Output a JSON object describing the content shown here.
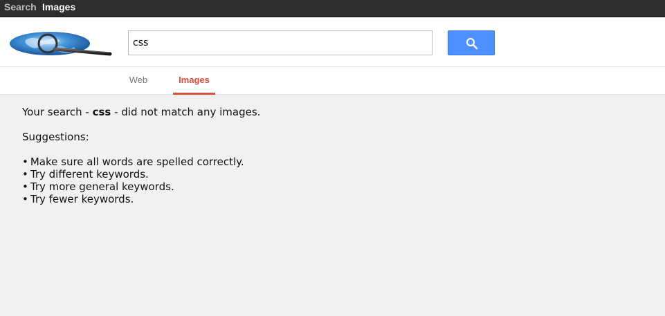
{
  "topbar": {
    "links": [
      {
        "label": "Search"
      },
      {
        "label": "Images"
      }
    ]
  },
  "header": {
    "logo_icon": "globe-magnifier-logo",
    "search": {
      "value": "css",
      "button_icon": "search-icon"
    }
  },
  "tabs": [
    {
      "label": "Web",
      "active": false
    },
    {
      "label": "Images",
      "active": true
    }
  ],
  "results": {
    "message_prefix": "Your search - ",
    "query": "css",
    "message_suffix": " - did not match any images.",
    "suggestions_title": "Suggestions:",
    "bullet": "•",
    "suggestions": [
      "Make sure all words are spelled correctly.",
      "Try different keywords.",
      "Try more general keywords.",
      "Try fewer keywords."
    ]
  },
  "colors": {
    "topbar_bg": "#2d2d2d",
    "button_blue": "#4d90fe",
    "active_tab_red": "#dd4b39",
    "page_bg": "#f1f1f1"
  }
}
